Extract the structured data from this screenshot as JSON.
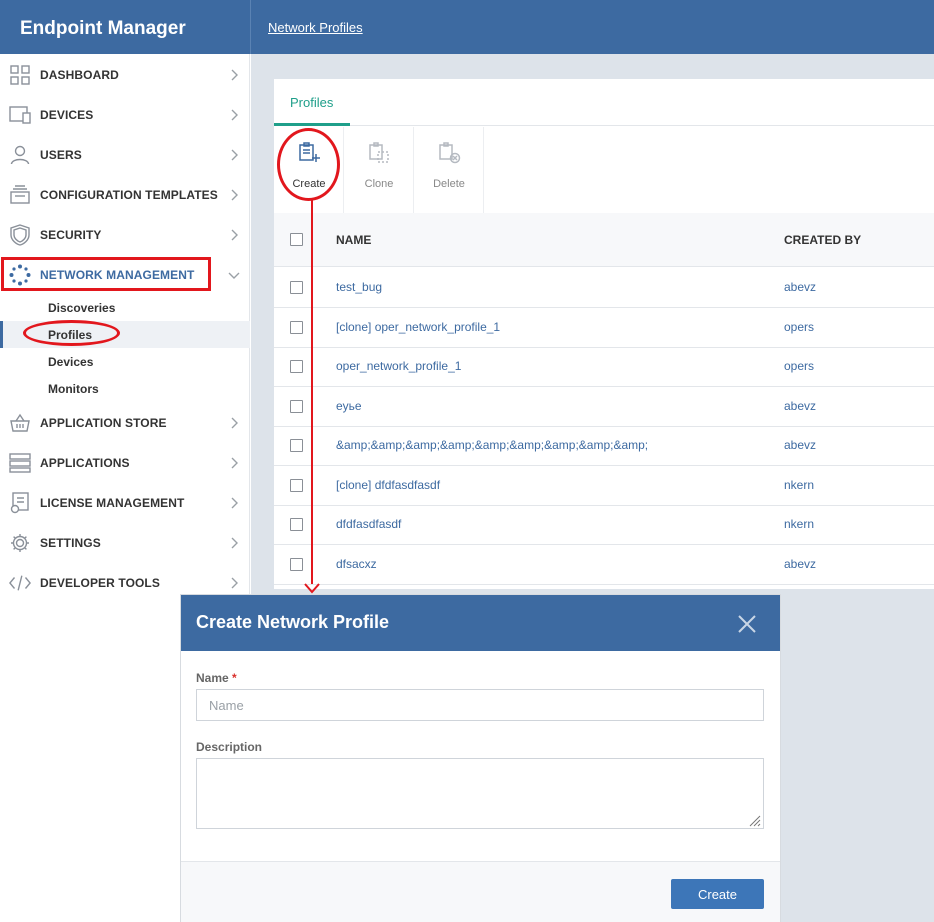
{
  "app": {
    "title": "Endpoint Manager"
  },
  "breadcrumb": "Network Profiles",
  "sidebar": {
    "items": [
      {
        "label": "DASHBOARD",
        "icon": "dashboard-icon"
      },
      {
        "label": "DEVICES",
        "icon": "devices-icon"
      },
      {
        "label": "USERS",
        "icon": "user-icon"
      },
      {
        "label": "CONFIGURATION TEMPLATES",
        "icon": "templates-icon"
      },
      {
        "label": "SECURITY",
        "icon": "shield-icon"
      },
      {
        "label": "NETWORK MANAGEMENT",
        "icon": "network-icon"
      },
      {
        "label": "APPLICATION STORE",
        "icon": "basket-icon"
      },
      {
        "label": "APPLICATIONS",
        "icon": "applications-icon"
      },
      {
        "label": "LICENSE MANAGEMENT",
        "icon": "license-icon"
      },
      {
        "label": "SETTINGS",
        "icon": "gear-icon"
      },
      {
        "label": "DEVELOPER TOOLS",
        "icon": "code-icon"
      }
    ],
    "subitems": [
      "Discoveries",
      "Profiles",
      "Devices",
      "Monitors"
    ],
    "active_subitem": "Profiles"
  },
  "tabs": [
    {
      "label": "Profiles",
      "active": true
    }
  ],
  "toolbar": {
    "create": "Create",
    "clone": "Clone",
    "delete": "Delete"
  },
  "table": {
    "columns": [
      "NAME",
      "CREATED BY"
    ],
    "rows": [
      {
        "name": "test_bug",
        "created_by": "abevz"
      },
      {
        "name": "[clone] oper_network_profile_1",
        "created_by": "opers"
      },
      {
        "name": "oper_network_profile_1",
        "created_by": "opers"
      },
      {
        "name": "eyье",
        "created_by": "abevz"
      },
      {
        "name": "&amp;&amp;&amp;&amp;&amp;&amp;&amp;&amp;&amp;",
        "created_by": "abevz"
      },
      {
        "name": "[clone] dfdfasdfasdf",
        "created_by": "nkern"
      },
      {
        "name": "dfdfasdfasdf",
        "created_by": "nkern"
      },
      {
        "name": "dfsacxz",
        "created_by": "abevz"
      }
    ]
  },
  "modal": {
    "title": "Create Network Profile",
    "name_label": "Name",
    "required_mark": "*",
    "name_placeholder": "Name",
    "name_value": "",
    "description_label": "Description",
    "description_value": "",
    "submit": "Create"
  },
  "colors": {
    "brand": "#3d6aa1",
    "accent_tab": "#1f9f8a",
    "annotation": "#e2171d",
    "link": "#3d6aa1"
  }
}
